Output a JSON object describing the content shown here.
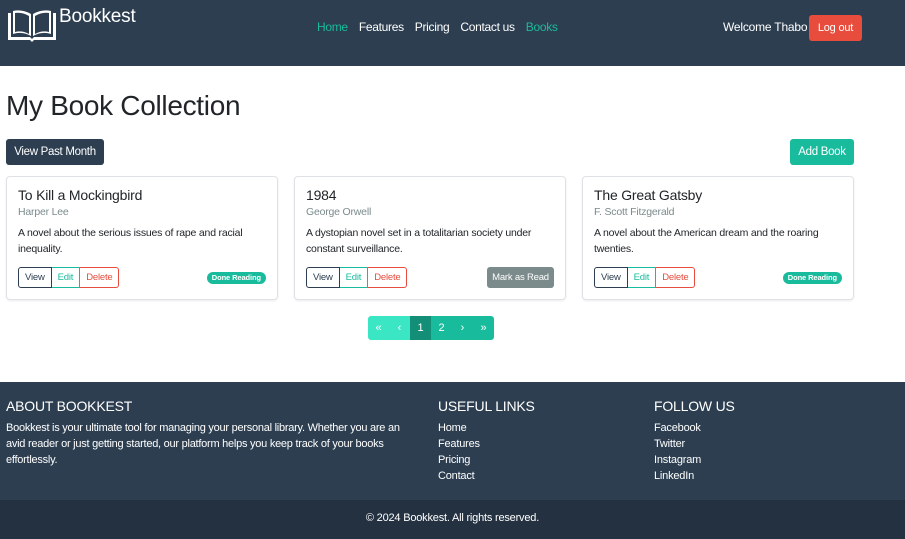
{
  "navbar": {
    "brand": "Bookkest",
    "links": [
      {
        "label": "Home",
        "accent": true
      },
      {
        "label": "Features",
        "accent": false
      },
      {
        "label": "Pricing",
        "accent": false
      },
      {
        "label": "Contact us",
        "accent": false
      },
      {
        "label": "Books",
        "accent": true
      }
    ],
    "welcome": "Welcome Thabo",
    "logout_label": "Log out"
  },
  "main": {
    "title": "My Book Collection",
    "past_month_label": "View Past Month",
    "add_book_label": "Add Book"
  },
  "books": [
    {
      "title": "To Kill a Mockingbird",
      "author": "Harper Lee",
      "description": "A novel about the serious issues of rape and racial inequality.",
      "status": "Done Reading"
    },
    {
      "title": "1984",
      "author": "George Orwell",
      "description": "A dystopian novel set in a totalitarian society under constant surveillance.",
      "status": "Mark as Read"
    },
    {
      "title": "The Great Gatsby",
      "author": "F. Scott Fitzgerald",
      "description": "A novel about the American dream and the roaring twenties.",
      "status": "Done Reading"
    }
  ],
  "card_actions": {
    "view": "View",
    "edit": "Edit",
    "delete": "Delete"
  },
  "pagination": {
    "first": "«",
    "prev": "‹",
    "pages": [
      "1",
      "2"
    ],
    "current": "1",
    "next": "›",
    "last": "»"
  },
  "footer": {
    "about": {
      "heading": "ABOUT BOOKKEST",
      "text": "Bookkest is your ultimate tool for managing your personal library. Whether you are an avid reader or just getting started, our platform helps you keep track of your books effortlessly."
    },
    "useful_links": {
      "heading": "USEFUL LINKS",
      "items": [
        "Home",
        "Features",
        "Pricing",
        "Contact"
      ]
    },
    "follow_us": {
      "heading": "FOLLOW US",
      "items": [
        "Facebook",
        "Twitter",
        "Instagram",
        "LinkedIn"
      ]
    },
    "copyright": "© 2024 Bookkest. All rights reserved."
  },
  "colors": {
    "primary": "#2c3e50",
    "success": "#18bc9c",
    "danger": "#e74c3c",
    "secondary": "#7b8a8b"
  },
  "icons": {
    "brand": "open-book-icon"
  }
}
